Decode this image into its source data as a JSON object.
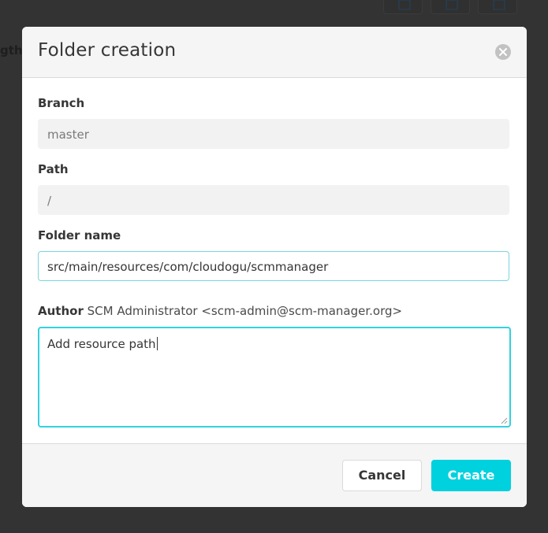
{
  "background": {
    "label_fragment": "gth"
  },
  "modal": {
    "title": "Folder creation",
    "branch": {
      "label": "Branch",
      "value": "master"
    },
    "path": {
      "label": "Path",
      "value": "/"
    },
    "folder_name": {
      "label": "Folder name",
      "value": "src/main/resources/com/cloudogu/scmmanager"
    },
    "author": {
      "label": "Author",
      "value": "SCM Administrator <scm-admin@scm-manager.org>"
    },
    "commit_message": {
      "value": "Add resource path"
    },
    "buttons": {
      "cancel": "Cancel",
      "create": "Create"
    }
  },
  "colors": {
    "primary": "#00d1df",
    "focus_border": "#33d1e0",
    "overlay": "#333333"
  }
}
